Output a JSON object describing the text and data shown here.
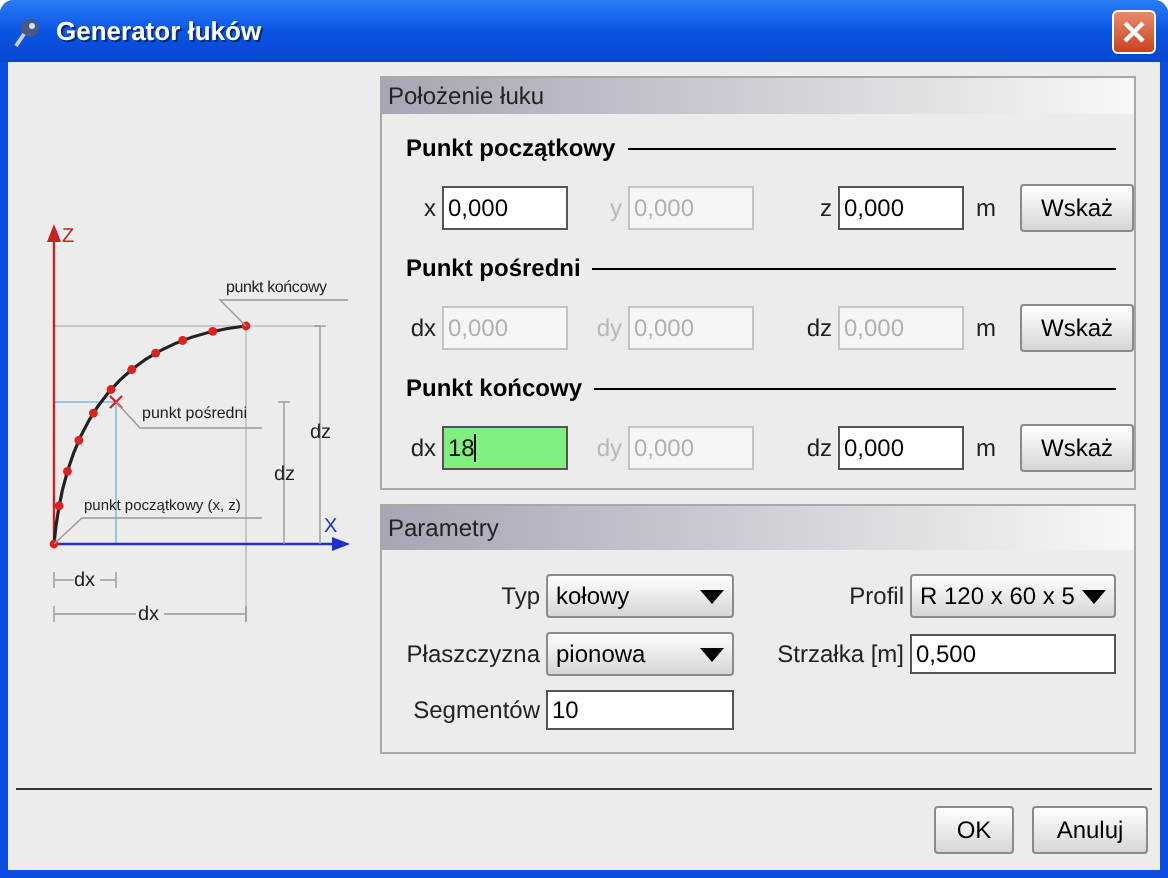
{
  "window": {
    "title": "Generator łuków"
  },
  "diagram": {
    "axis_z": "Z",
    "axis_x": "X",
    "end_label": "punkt końcowy",
    "mid_label": "punkt pośredni",
    "start_label": "punkt początkowy (x, z)",
    "dz_outer": "dz",
    "dz_inner": "dz",
    "dx_inner": "dx",
    "dx_outer": "dx"
  },
  "position": {
    "title": "Położenie łuku",
    "sections": [
      {
        "title": "Punkt początkowy",
        "unit": "m",
        "button": "Wskaż",
        "fields": [
          {
            "label": "x",
            "label_disabled": false,
            "value": "0,000",
            "disabled": false,
            "focused": false
          },
          {
            "label": "y",
            "label_disabled": true,
            "value": "0,000",
            "disabled": true,
            "focused": false
          },
          {
            "label": "z",
            "label_disabled": false,
            "value": "0,000",
            "disabled": false,
            "focused": false
          }
        ]
      },
      {
        "title": "Punkt pośredni",
        "unit": "m",
        "button": "Wskaż",
        "fields": [
          {
            "label": "dx",
            "label_disabled": false,
            "value": "0,000",
            "disabled": true,
            "focused": false
          },
          {
            "label": "dy",
            "label_disabled": true,
            "value": "0,000",
            "disabled": true,
            "focused": false
          },
          {
            "label": "dz",
            "label_disabled": false,
            "value": "0,000",
            "disabled": true,
            "focused": false
          }
        ]
      },
      {
        "title": "Punkt końcowy",
        "unit": "m",
        "button": "Wskaż",
        "fields": [
          {
            "label": "dx",
            "label_disabled": false,
            "value": "18",
            "disabled": false,
            "focused": true
          },
          {
            "label": "dy",
            "label_disabled": true,
            "value": "0,000",
            "disabled": true,
            "focused": false
          },
          {
            "label": "dz",
            "label_disabled": false,
            "value": "0,000",
            "disabled": false,
            "focused": false
          }
        ]
      }
    ]
  },
  "parameters": {
    "title": "Parametry",
    "items": [
      {
        "kind": "select",
        "label": "Typ",
        "value": "kołowy"
      },
      {
        "kind": "select",
        "label": "Profil",
        "value": "R 120 x 60 x 5"
      },
      {
        "kind": "select",
        "label": "Płaszczyzna",
        "value": "pionowa"
      },
      {
        "kind": "input",
        "label": "Strzałka [m]",
        "value": "0,500"
      },
      {
        "kind": "input",
        "label": "Segmentów",
        "value": "10"
      }
    ]
  },
  "buttons": [
    "OK",
    "Anuluj"
  ]
}
